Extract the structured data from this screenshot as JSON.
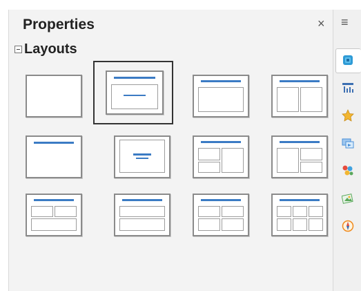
{
  "panel": {
    "title": "Properties",
    "close_icon": "×"
  },
  "section": {
    "title": "Layouts",
    "collapse_state": "expanded"
  },
  "layouts": [
    {
      "name": "blank"
    },
    {
      "name": "title-content",
      "selected": true
    },
    {
      "name": "title-content-box"
    },
    {
      "name": "title-2-content"
    },
    {
      "name": "title-only"
    },
    {
      "name": "centered-text"
    },
    {
      "name": "title-2content-and-content"
    },
    {
      "name": "title-content-and-2content"
    },
    {
      "name": "title-2content-over-content"
    },
    {
      "name": "title-content-over-content"
    },
    {
      "name": "title-4-content"
    },
    {
      "name": "title-6-content"
    }
  ],
  "sidebar": {
    "menu_icon": "≡",
    "tabs": [
      {
        "name": "properties-icon",
        "color": "#2f9bd6",
        "active": true
      },
      {
        "name": "slide-transition-icon",
        "color": "#3c6fb2"
      },
      {
        "name": "master-slides-icon",
        "color": "#f2b632"
      },
      {
        "name": "custom-animation-icon",
        "color": "#4a8fd8"
      },
      {
        "name": "styles-icon",
        "color": "#e64b3c"
      },
      {
        "name": "gallery-icon",
        "color": "#5aa85a"
      },
      {
        "name": "navigator-icon",
        "color": "#f08a1c"
      }
    ]
  },
  "colors": {
    "accent": "#3b7bc4",
    "panel_bg": "#f3f3f3"
  }
}
